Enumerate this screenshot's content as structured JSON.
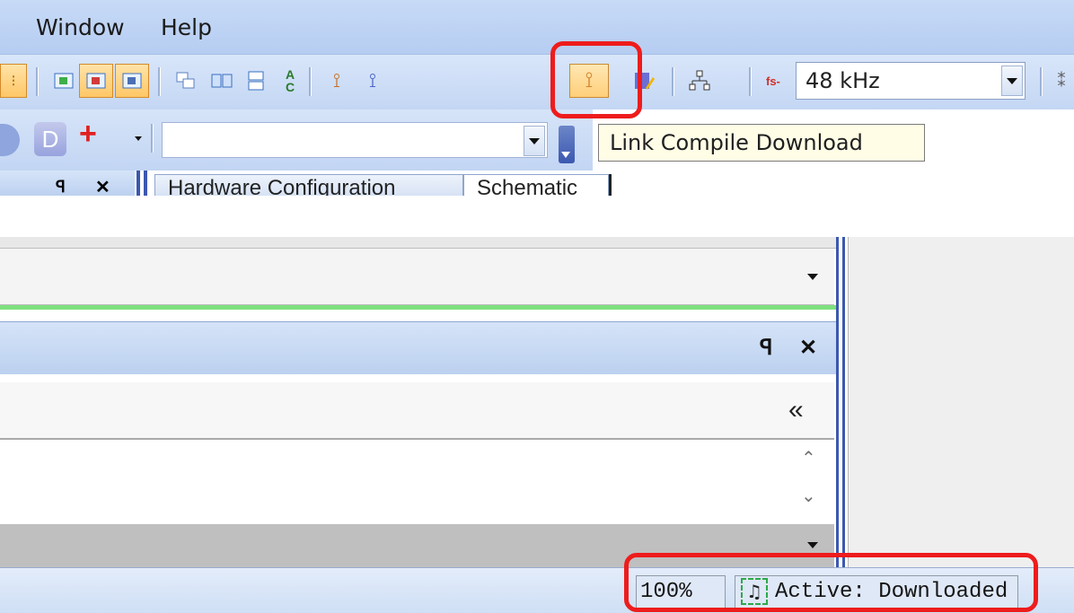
{
  "menu": {
    "items": [
      "Window",
      "Help"
    ]
  },
  "toolbar": {
    "sample_rate_prefix": "fs-",
    "sample_rate_value": "48 kHz",
    "link_compile_download_tooltip": "Link Compile Download"
  },
  "toolbar2": {
    "add_symbol": "+",
    "d_label": "D"
  },
  "tabs": [
    {
      "label": "Hardware Configuration"
    },
    {
      "label": "Schematic"
    }
  ],
  "panel": {
    "collapse_glyph": "«",
    "pin_glyph": "ꟼ",
    "close_glyph": "✕"
  },
  "status": {
    "zoom": "100%",
    "state": "Active: Downloaded"
  },
  "colors": {
    "highlight": "#ee1c1c",
    "accent_blue": "#3b58b0"
  }
}
